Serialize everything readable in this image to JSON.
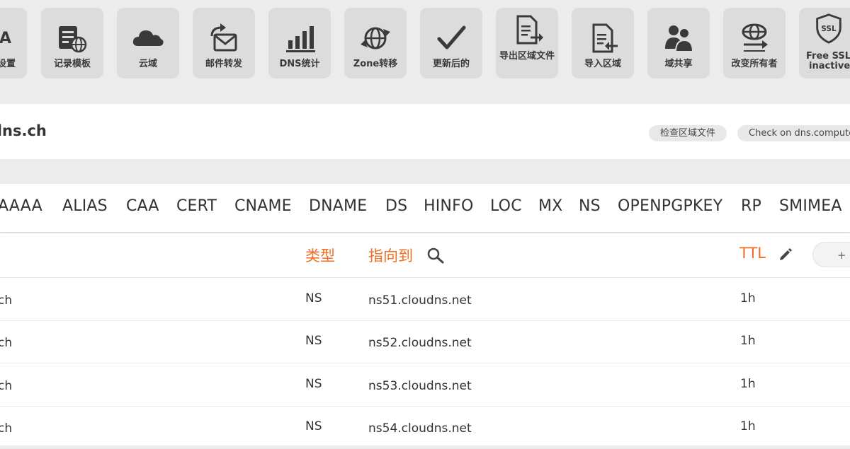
{
  "toolbar": {
    "items": [
      {
        "label": "设置",
        "title_partial": "DA",
        "icon": "soa-icon"
      },
      {
        "label": "记录模板",
        "icon": "record-template-icon"
      },
      {
        "label": "云域",
        "icon": "cloud-icon"
      },
      {
        "label": "邮件转发",
        "icon": "mail-forward-icon"
      },
      {
        "label": "DNS统计",
        "icon": "bar-chart-icon"
      },
      {
        "label": "Zone转移",
        "icon": "globe-transfer-icon"
      },
      {
        "label": "更新后的",
        "icon": "checkmark-icon"
      },
      {
        "label": "导出区域文件",
        "icon": "export-file-icon"
      },
      {
        "label": "导入区域",
        "icon": "import-file-icon"
      },
      {
        "label": "域共享",
        "icon": "users-icon"
      },
      {
        "label": "改变所有者",
        "icon": "globe-owner-icon"
      },
      {
        "label_line1": "Free SSL",
        "label_line2": "inactive",
        "icon": "ssl-shield-icon"
      }
    ]
  },
  "domain": {
    "name": "dns.ch",
    "check_zone_label": "检查区域文件",
    "check_dns_label": "Check on dns.computer"
  },
  "record_types": [
    "AAAA",
    "ALIAS",
    "CAA",
    "CERT",
    "CNAME",
    "DNAME",
    "DS",
    "HINFO",
    "LOC",
    "MX",
    "NS",
    "OPENPGPKEY",
    "RP",
    "SMIMEA"
  ],
  "table": {
    "headers": {
      "type": "类型",
      "points_to": "指向到",
      "ttl": "TTL",
      "add": "+ 添"
    },
    "rows": [
      {
        "host": "ch",
        "type": "NS",
        "points_to": "ns51.cloudns.net",
        "ttl": "1h"
      },
      {
        "host": "ch",
        "type": "NS",
        "points_to": "ns52.cloudns.net",
        "ttl": "1h"
      },
      {
        "host": "ch",
        "type": "NS",
        "points_to": "ns53.cloudns.net",
        "ttl": "1h"
      },
      {
        "host": "ch",
        "type": "NS",
        "points_to": "ns54.cloudns.net",
        "ttl": "1h"
      }
    ]
  },
  "colors": {
    "accent": "#f26c22",
    "icon": "#3a3a3a",
    "tile": "#dcdcdc"
  }
}
